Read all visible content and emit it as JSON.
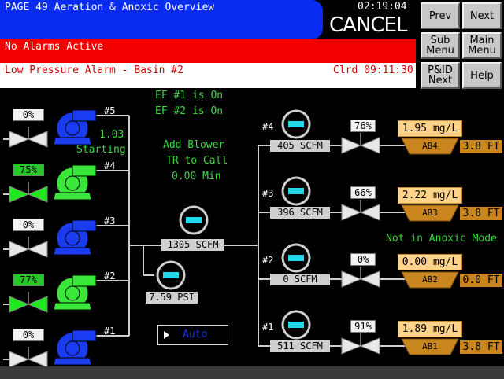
{
  "header": {
    "title": "PAGE 49 Aeration & Anoxic Overview",
    "time": "02:19:04",
    "cancel_label": "CANCEL"
  },
  "alarms": {
    "status": "No Alarms Active",
    "last_alarm": "Low Pressure Alarm - Basin #2",
    "cleared": "Clrd 09:11:30"
  },
  "nav": {
    "prev": "Prev",
    "next": "Next",
    "sub_menu": "Sub\nMenu",
    "main_menu": "Main\nMenu",
    "pid_next": "P&ID\nNext",
    "help": "Help"
  },
  "messages": {
    "ef1": "EF #1 is On",
    "ef2": "EF #2 is On",
    "add_blower": "Add Blower",
    "tr_to_call": "TR to Call",
    "minutes": "0.00 Min",
    "anoxic": "Not in Anoxic Mode",
    "blower5_speed": "1.03",
    "blower5_status": "Starting"
  },
  "blowers": [
    {
      "num": "#5",
      "valve": "0%",
      "running": false
    },
    {
      "num": "#4",
      "valve": "75%",
      "running": true
    },
    {
      "num": "#3",
      "valve": "0%",
      "running": false
    },
    {
      "num": "#2",
      "valve": "77%",
      "running": true
    },
    {
      "num": "#1",
      "valve": "0%",
      "running": false
    }
  ],
  "header_main": {
    "flow": "1305 SCFM",
    "pressure": "7.59 PSI"
  },
  "basins": [
    {
      "num": "#4",
      "flow": "405 SCFM",
      "valve": "76%",
      "do": "1.95 mg/L",
      "name": "AB4",
      "level": "3.8 FT"
    },
    {
      "num": "#3",
      "flow": "396 SCFM",
      "valve": "66%",
      "do": "2.22 mg/L",
      "name": "AB3",
      "level": "3.8 FT"
    },
    {
      "num": "#2",
      "flow": "0 SCFM",
      "valve": "0%",
      "do": "0.00 mg/L",
      "name": "AB2",
      "level": "0.0 FT"
    },
    {
      "num": "#1",
      "flow": "511 SCFM",
      "valve": "91%",
      "do": "1.89 mg/L",
      "name": "AB1",
      "level": "3.8 FT"
    }
  ],
  "mode": {
    "label": "Auto"
  },
  "colors": {
    "header_bg": "#0a2cf0",
    "alarm_red": "#f20000",
    "blower_off": "#1a3cf0",
    "blower_on": "#39e639",
    "text_green": "#3cd63c",
    "do_bg": "#ffd48a",
    "level_bg": "#c9851e"
  }
}
